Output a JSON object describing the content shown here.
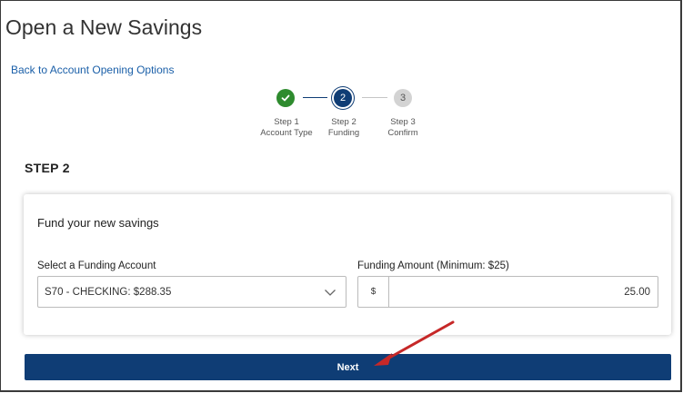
{
  "page": {
    "title": "Open a New Savings"
  },
  "nav": {
    "back_link": "Back to Account Opening Options"
  },
  "stepper": {
    "steps": [
      {
        "number": "",
        "title": "Step 1",
        "subtitle": "Account Type",
        "state": "complete"
      },
      {
        "number": "2",
        "title": "Step 2",
        "subtitle": "Funding",
        "state": "active"
      },
      {
        "number": "3",
        "title": "Step 3",
        "subtitle": "Confirm",
        "state": "pending"
      }
    ]
  },
  "section": {
    "heading": "STEP 2"
  },
  "card": {
    "title": "Fund your new savings",
    "funding_account": {
      "label": "Select a Funding Account",
      "selected": "S70 - CHECKING: $288.35"
    },
    "funding_amount": {
      "label": "Funding Amount (Minimum: $25)",
      "prefix": "$",
      "value": "25.00"
    }
  },
  "actions": {
    "next_label": "Next"
  },
  "colors": {
    "primary": "#0f3d75",
    "success": "#2e8b2e",
    "link": "#1a5fa8",
    "annotation_arrow": "#c62828"
  }
}
